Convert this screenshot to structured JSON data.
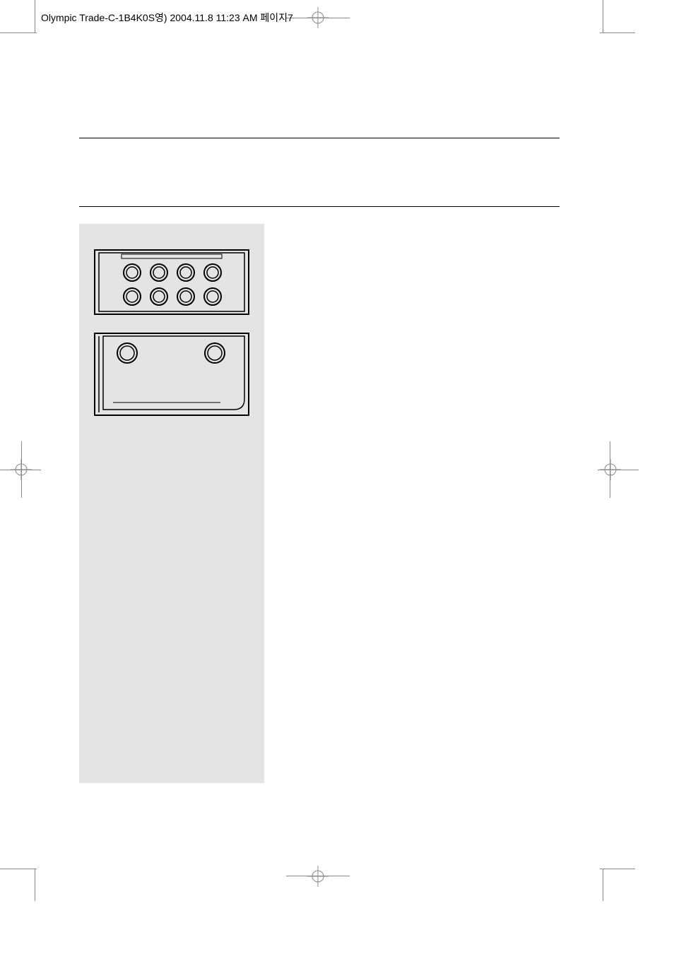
{
  "header": {
    "text": "Olympic Trade-C-1B4K0S영)  2004.11.8 11:23 AM  페이지7"
  }
}
